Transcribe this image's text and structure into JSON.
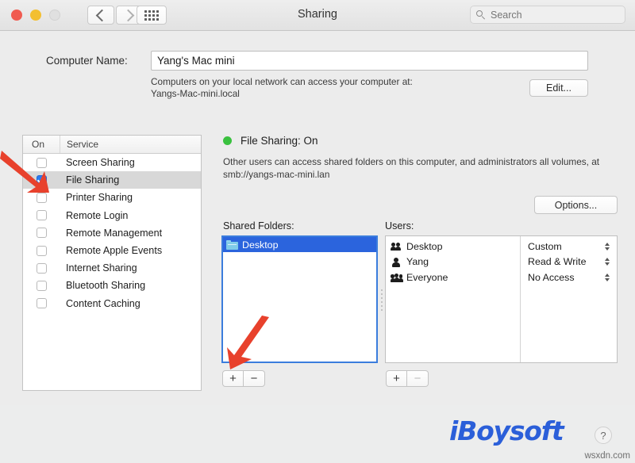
{
  "window": {
    "title": "Sharing",
    "traffic_lights": [
      "close",
      "minimize",
      "zoom"
    ],
    "nav": {
      "back": "back-chevron",
      "forward": "forward-chevron",
      "grid": "show-all-grid"
    }
  },
  "search": {
    "placeholder": "Search",
    "value": "",
    "icon": "search-icon"
  },
  "computer_name": {
    "label": "Computer Name:",
    "value": "Yang's Mac mini",
    "help_line1": "Computers on your local network can access your computer at:",
    "help_line2": "Yangs-Mac-mini.local",
    "edit_button": "Edit..."
  },
  "services_table": {
    "columns": [
      "On",
      "Service"
    ],
    "rows": [
      {
        "name": "Screen Sharing",
        "on": false,
        "selected": false
      },
      {
        "name": "File Sharing",
        "on": true,
        "selected": true
      },
      {
        "name": "Printer Sharing",
        "on": false,
        "selected": false
      },
      {
        "name": "Remote Login",
        "on": false,
        "selected": false
      },
      {
        "name": "Remote Management",
        "on": false,
        "selected": false
      },
      {
        "name": "Remote Apple Events",
        "on": false,
        "selected": false
      },
      {
        "name": "Internet Sharing",
        "on": false,
        "selected": false
      },
      {
        "name": "Bluetooth Sharing",
        "on": false,
        "selected": false
      },
      {
        "name": "Content Caching",
        "on": false,
        "selected": false
      }
    ]
  },
  "file_sharing": {
    "status_text": "File Sharing: On",
    "status_color": "#3ac13f",
    "description": "Other users can access shared folders on this computer, and administrators all volumes, at smb://yangs-mac-mini.lan",
    "options_button": "Options..."
  },
  "shared_folders": {
    "label": "Shared Folders:",
    "items": [
      {
        "name": "Desktop",
        "selected": true,
        "icon": "folder-icon"
      }
    ],
    "add_button": "+",
    "remove_button": "−"
  },
  "users": {
    "label": "Users:",
    "rows": [
      {
        "name": "Desktop",
        "icon": "group-icon",
        "permission": "Custom"
      },
      {
        "name": "Yang",
        "icon": "person-icon",
        "permission": "Read & Write"
      },
      {
        "name": "Everyone",
        "icon": "everyone-icon",
        "permission": "No Access"
      }
    ],
    "add_button": "+",
    "remove_button": "−"
  },
  "footer": {
    "logo_text": "iBoysoft",
    "logo_color": "#2b5fd9",
    "help_button": "?",
    "watermark": "wsxdn.com"
  },
  "annotations": {
    "arrow_color": "#e8412c",
    "arrow_file_sharing_checkbox": "points to File Sharing checkbox",
    "arrow_add_folder": "points to add shared folder button"
  }
}
